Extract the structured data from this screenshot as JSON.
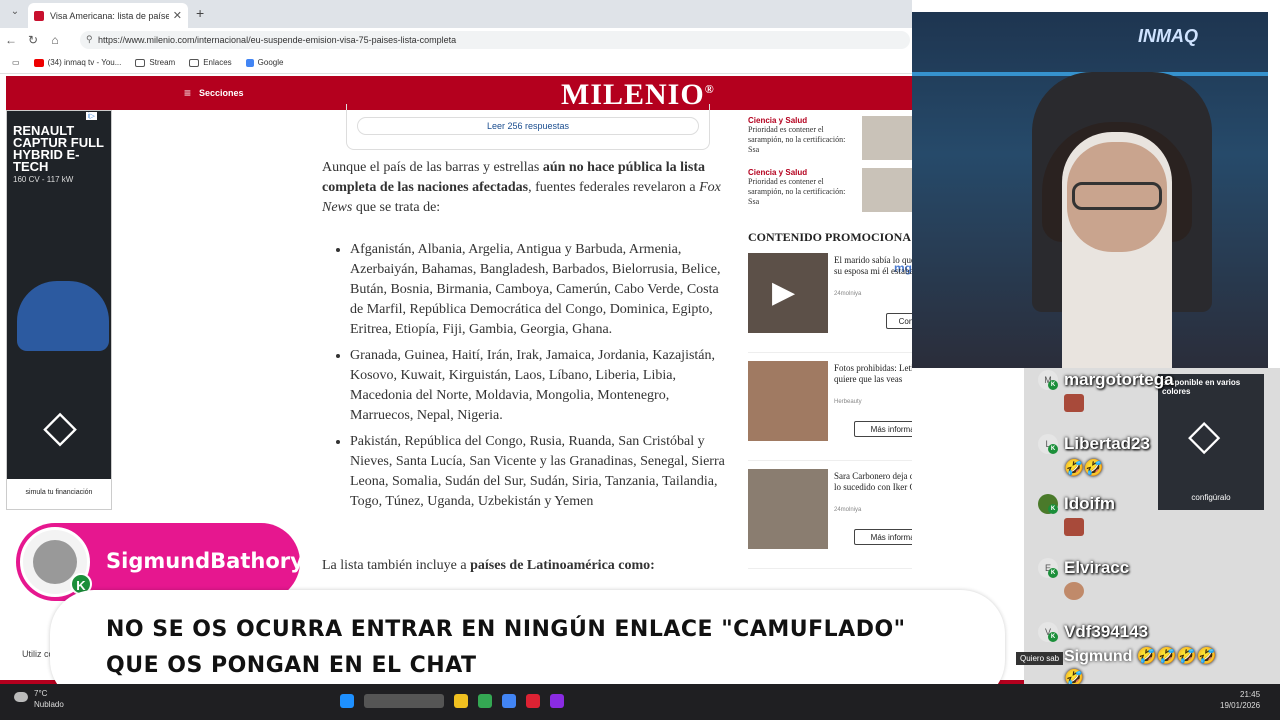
{
  "browser": {
    "tab_title": "Visa Americana: lista de países afe",
    "tab_close": "✕",
    "new_tab": "+",
    "url": "https://www.milenio.com/internacional/eu-suspende-emision-visa-75-paises-lista-completa",
    "bookmarks": [
      "(34) inmaq tv - You...",
      "Stream",
      "Enlaces",
      "Google"
    ]
  },
  "site": {
    "menu_label": "Secciones",
    "logo": "MILENIO",
    "logo_mark": "®",
    "ad_left": {
      "headline": "RENAULT CAPTUR FULL HYBRID E-TECH",
      "spec": "160 CV - 117 kW",
      "footer": "simula tu financiación"
    },
    "reply_button": "Leer 256 respuestas",
    "intro_1": "Aunque el país de las barras y estrellas ",
    "intro_bold": "aún no hace pública la lista completa de las naciones afectadas",
    "intro_2": ", fuentes federales revelaron a ",
    "intro_source": "Fox News",
    "intro_3": " que se trata de:",
    "countries": [
      "Afganistán, Albania, Argelia, Antigua y Barbuda, Armenia, Azerbaiyán, Bahamas, Bangladesh, Barbados, Bielorrusia, Belice, Bután, Bosnia, Birmania, Camboya, Camerún, Cabo Verde, Costa de Marfil, República Democrática del Congo, Dominica, Egipto, Eritrea, Etiopía, Fiji, Gambia, Georgia, Ghana.",
      "Granada, Guinea, Haití, Irán, Irak, Jamaica, Jordania, Kazajistán, Kosovo, Kuwait, Kirguistán, Laos, Líbano, Liberia, Libia, Macedonia del Norte, Moldavia, Mongolia, Montenegro, Marruecos, Nepal, Nigeria.",
      "Pakistán, República del Congo, Rusia, Ruanda, San Cristóbal y Nieves, Santa Lucía, San Vicente y las Granadinas, Senegal, Sierra Leona, Somalia, Sudán del Sur, Sudán, Siria, Tanzania, Tailandia, Togo, Túnez, Uganda, Uzbekistán y Yemen"
    ],
    "tail_1": "La lista también incluye a ",
    "tail_bold": "países de Latinoamérica como:",
    "news": [
      {
        "category": "Ciencia y Salud",
        "headline": "Prioridad es contener el sarampión, no la certificación: Ssa"
      },
      {
        "category": "Ciencia y Salud",
        "headline": "Prioridad es contener el sarampión, no la certificación: Ssa"
      }
    ],
    "promo_heading": "CONTENIDO PROMOCIONA",
    "promo_source": "mg",
    "cards": [
      {
        "text": "El marido sabía lo que hacía su esposa mi él estaba fuera",
        "source": "24molniya",
        "button": "Con"
      },
      {
        "text": "Fotos prohibidas: Letizia no quiere que las veas",
        "source": "Herbeauty",
        "button": "Más información"
      },
      {
        "text": "Sara Carbonero deja de ocultar lo sucedido con Iker Casillas",
        "source": "24molniya",
        "button": "Más información"
      }
    ],
    "cookie_text": "Utiliz cookies"
  },
  "stream": {
    "cam_logo": "INMAQ",
    "overlay_user": "SigmundBathory",
    "kick_badge": "K",
    "banner_text": "NO SE OS OCURRA ENTRAR EN NINGÚN ENLACE \"CAMUFLADO\" QUE OS PONGAN EN EL CHAT"
  },
  "chat": {
    "ad_text": "Disponible en varios colores",
    "ad_footer": "configúralo",
    "messages": [
      {
        "initial": "M",
        "user": "margotortega",
        "body": ""
      },
      {
        "initial": "L",
        "user": "Libertad23",
        "body": "🤣🤣"
      },
      {
        "initial": "",
        "user": "Idoifm",
        "body": ""
      },
      {
        "initial": "E",
        "user": "Elviracc",
        "body": ""
      },
      {
        "initial": "V",
        "user": "Vdf394143",
        "body": "Sigmund 🤣🤣🤣🤣"
      }
    ],
    "overflow_emoji": "🤣",
    "ad_bottom": "Quiero sab"
  },
  "taskbar": {
    "temp": "7°C",
    "weather": "Nublado",
    "time": "21:45",
    "date": "19/01/2026"
  },
  "colors": {
    "brand": "#b4001e",
    "pill": "#e6178f",
    "kick": "#1b8f3a"
  }
}
